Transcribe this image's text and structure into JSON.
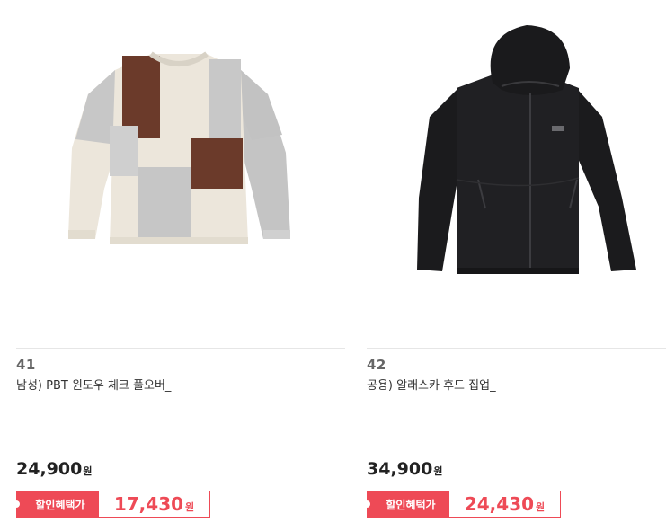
{
  "products": [
    {
      "rank": "41",
      "name": "남성) PBT 윈도우 체크 풀오버_",
      "price": "24,900",
      "price_unit": "원",
      "discount_label": "할인혜택가",
      "discount_price": "17,430",
      "discount_unit": "원",
      "image": "checkered-knit-sweater-image"
    },
    {
      "rank": "42",
      "name": "공용) 알래스카 후드 집업_",
      "price": "34,900",
      "price_unit": "원",
      "discount_label": "할인혜택가",
      "discount_price": "24,430",
      "discount_unit": "원",
      "image": "black-hooded-zip-jacket-image"
    }
  ],
  "colors": {
    "discount_accent": "#ee4a56",
    "price_text": "#222222",
    "rank_text": "#666666"
  }
}
